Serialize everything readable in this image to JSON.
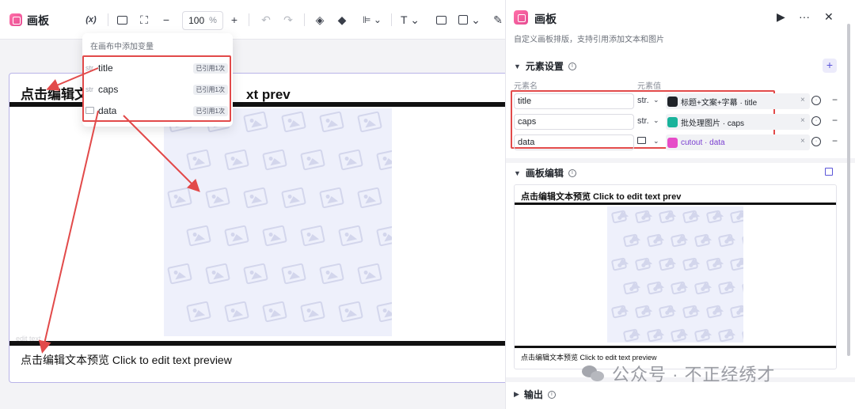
{
  "app": {
    "title": "画板"
  },
  "toolbar": {
    "variable_button": "(x)",
    "zoom_value": "100",
    "zoom_unit": "%"
  },
  "variable_menu": {
    "header": "在画布中添加变量",
    "items": [
      {
        "type": "str",
        "name": "title",
        "ref": "已引用1次"
      },
      {
        "type": "str",
        "name": "caps",
        "ref": "已引用1次"
      },
      {
        "type": "img",
        "name": "data",
        "ref": "已引用1次"
      }
    ]
  },
  "canvas": {
    "title": "点击编辑文",
    "title_tail": "xt prev",
    "caption": "点击编辑文本预览 Click to edit text preview",
    "faint": "edit text"
  },
  "panel": {
    "title": "画板",
    "description": "自定义画板排版，支持引用添加文本和图片",
    "element_section": "元素设置",
    "col_name": "元素名",
    "col_value": "元素值",
    "elements": [
      {
        "name": "title",
        "type": "str.",
        "source": "标题+文案+字幕 · title",
        "icon_color": "#1f2329"
      },
      {
        "name": "caps",
        "type": "str.",
        "source": "批处理图片 · caps",
        "icon_color": "#19b39b"
      },
      {
        "name": "data",
        "type": "img",
        "source": "cutout · data",
        "icon_color": "#e64cc8"
      }
    ],
    "edit_section": "画板编辑",
    "preview_title": "点击编辑文本预览 Click to edit text prev",
    "preview_caption": "点击编辑文本预览 Click to edit text preview",
    "output_section": "输出"
  },
  "watermark": "公众号 · 不正经绣才",
  "colors": {
    "accent": "#5b55d8",
    "annotation_red": "#e24a4a",
    "brand_pink": "#e64c92"
  }
}
